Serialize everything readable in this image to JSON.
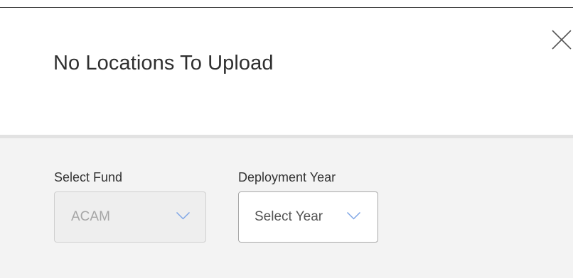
{
  "modal": {
    "title": "No Locations To Upload"
  },
  "fund": {
    "label": "Select Fund",
    "value": "ACAM",
    "disabled": true
  },
  "deployment_year": {
    "label": "Deployment Year",
    "placeholder": "Select Year"
  },
  "colors": {
    "chevron": "#7fa6e6",
    "body_background": "#f3f3f3"
  },
  "icons": {
    "close": "close-icon",
    "dropdown": "chevron-down-icon"
  }
}
